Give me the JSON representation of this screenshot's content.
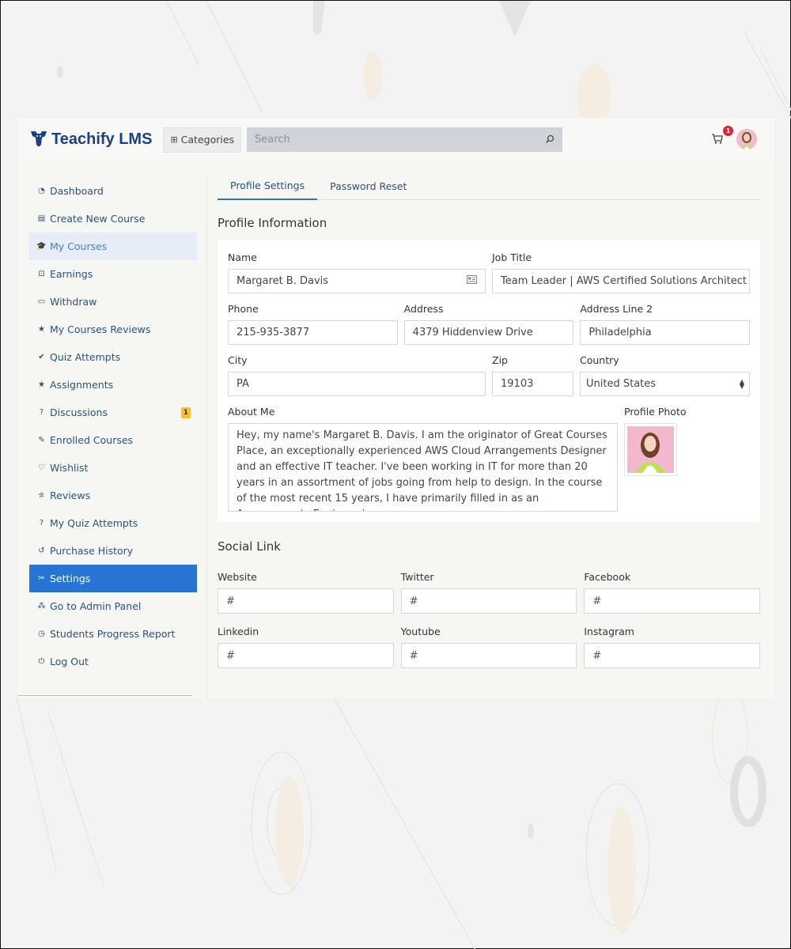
{
  "brand": {
    "name": "Teachify LMS",
    "color": "#1d3f84"
  },
  "header": {
    "categories_label": "Categories",
    "search_placeholder": "Search",
    "cart_count": "1"
  },
  "sidebar": {
    "items": [
      {
        "label": "Dashboard",
        "icon": "dashboard-icon",
        "glyph": "◔"
      },
      {
        "label": "Create New Course",
        "icon": "course-card-icon",
        "glyph": "▤"
      },
      {
        "label": "My Courses",
        "icon": "graduation-cap-icon",
        "glyph": "🎓",
        "state": "hover"
      },
      {
        "label": "Earnings",
        "icon": "earnings-icon",
        "glyph": "⊡"
      },
      {
        "label": "Withdraw",
        "icon": "wallet-icon",
        "glyph": "▭"
      },
      {
        "label": "My Courses Reviews",
        "icon": "star-icon",
        "glyph": "★"
      },
      {
        "label": "Quiz Attempts",
        "icon": "double-check-icon",
        "glyph": "✔"
      },
      {
        "label": "Assignments",
        "icon": "star-icon",
        "glyph": "★"
      },
      {
        "label": "Discussions",
        "icon": "question-circle-icon",
        "glyph": "?",
        "badge": "1"
      },
      {
        "label": "Enrolled Courses",
        "icon": "edit-icon",
        "glyph": "✎"
      },
      {
        "label": "Wishlist",
        "icon": "heart-icon",
        "glyph": "♡"
      },
      {
        "label": "Reviews",
        "icon": "star-half-icon",
        "glyph": "✮"
      },
      {
        "label": "My Quiz Attempts",
        "icon": "question-circle-icon",
        "glyph": "?"
      },
      {
        "label": "Purchase History",
        "icon": "history-icon",
        "glyph": "↺"
      },
      {
        "label": "Settings",
        "icon": "tools-icon",
        "glyph": "✂",
        "state": "active"
      },
      {
        "label": "Go to Admin Panel",
        "icon": "nodes-icon",
        "glyph": "⁂"
      },
      {
        "label": "Students Progress Report",
        "icon": "pie-clock-icon",
        "glyph": "◷"
      },
      {
        "label": "Log Out",
        "icon": "logout-icon",
        "glyph": "⏻"
      }
    ],
    "active_color": "#2874d2",
    "badge_color": "#f8c033"
  },
  "tabs": [
    {
      "label": "Profile Settings",
      "active": true
    },
    {
      "label": "Password Reset",
      "active": false
    }
  ],
  "profile": {
    "section_title": "Profile Information",
    "name": {
      "label": "Name",
      "value": "Margaret B. Davis"
    },
    "job_title": {
      "label": "Job Title",
      "value": "Team Leader | AWS Certified Solutions Architect -"
    },
    "phone": {
      "label": "Phone",
      "value": "215-935-3877"
    },
    "address": {
      "label": "Address",
      "value": "4379 Hiddenview Drive"
    },
    "address2": {
      "label": "Address Line 2",
      "value": "Philadelphia"
    },
    "city": {
      "label": "City",
      "value": "PA"
    },
    "zip": {
      "label": "Zip",
      "value": "19103"
    },
    "country": {
      "label": "Country",
      "value": "United States"
    },
    "about": {
      "label": "About Me",
      "value": "Hey, my name's Margaret B. Davis. I am the originator of Great Courses Place, an exceptionally experienced AWS Cloud Arrangements Designer and an effective IT teacher. I've been working in IT for more than 20 years in an assortment of jobs going from help to design. In the course of the most recent 15 years, I have primarily filled in as an Arrangements Engineer in"
    },
    "photo": {
      "label": "Profile Photo"
    }
  },
  "social": {
    "section_title": "Social Link",
    "fields": [
      {
        "label": "Website",
        "value": "#"
      },
      {
        "label": "Twitter",
        "value": "#"
      },
      {
        "label": "Facebook",
        "value": "#"
      },
      {
        "label": "Linkedin",
        "value": "#"
      },
      {
        "label": "Youtube",
        "value": "#"
      },
      {
        "label": "Instagram",
        "value": "#"
      }
    ]
  }
}
